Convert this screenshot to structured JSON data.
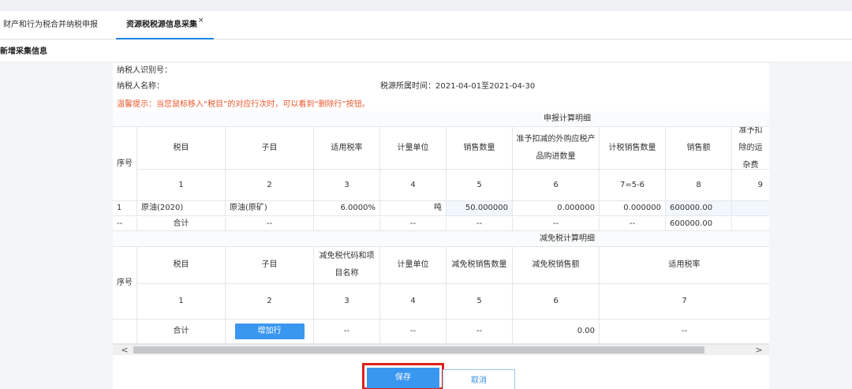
{
  "tabs": [
    {
      "label": "财产和行为税合并纳税申报"
    },
    {
      "label": "资源税税源信息采集",
      "close": "×"
    }
  ],
  "sub_title": "新增采集信息",
  "info": {
    "taxpayer_id_label": "纳税人识别号：",
    "taxpayer_name_label": "纳税人名称：",
    "period": "税源所属时间：2021-04-01至2021-04-30",
    "tip": "温馨提示：当您鼠标移入“税目”的对应行次时，可以看到“删除行”按钮。"
  },
  "declare": {
    "section_title": "申报计算明细",
    "seq_header": "序号",
    "headers": [
      "税目",
      "子目",
      "适用税率",
      "计量单位",
      "销售数量",
      "准予扣减的外购应税产品购进数量",
      "计税销售数量",
      "销售额",
      "准予扣除的运杂费"
    ],
    "header_nums": [
      "1",
      "2",
      "3",
      "4",
      "5",
      "6",
      "7=5-6",
      "8",
      "9"
    ],
    "rows": [
      {
        "seq": "1",
        "item": "原油(2020)",
        "sub": "原油(原矿)",
        "rate": "6.0000%",
        "unit": "吨",
        "qty": "50.000000",
        "deduct": "0.000000",
        "taxqty": "0.000000",
        "amount": "600000.00",
        "fee": ""
      }
    ],
    "total": {
      "seq": "--",
      "label": "合计",
      "sub": "--",
      "rate": "",
      "unit": "--",
      "qty": "--",
      "deduct": "--",
      "taxqty": "--",
      "amount": "600000.00",
      "fee": ""
    }
  },
  "relief": {
    "section_title": "减免税计算明细",
    "seq_header": "序号",
    "headers": [
      "税目",
      "子目",
      "减免税代码和项目名称",
      "计量单位",
      "减免税销售数量",
      "减免税销售额",
      "适用税率"
    ],
    "header_nums": [
      "1",
      "2",
      "3",
      "4",
      "5",
      "6",
      "7"
    ],
    "total": {
      "label": "合计",
      "add_button": "增加行",
      "c3": "--",
      "c4": "--",
      "c5": "--",
      "c6": "0.00",
      "c7": "--"
    }
  },
  "scroll": {
    "left": "<",
    "right": ">"
  },
  "actions": {
    "save": "保存",
    "cancel": "取消"
  },
  "colors": {
    "accent": "#3a97f0",
    "tip": "#e8572c",
    "highlight": "#e0201b"
  }
}
